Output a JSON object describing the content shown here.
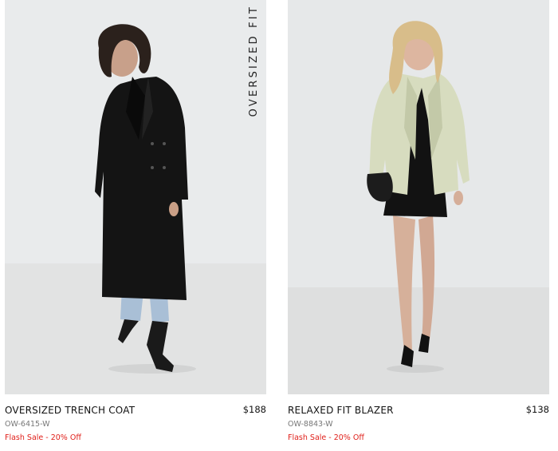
{
  "products": [
    {
      "name": "OVERSIZED TRENCH COAT",
      "sku": "OW-6415-W",
      "price": "$188",
      "promo": "Flash Sale - 20% Off",
      "image_label": "OVERSIZED FIT",
      "image_subject": "model wearing black oversized trench coat with light-wash jeans"
    },
    {
      "name": "RELAXED FIT BLAZER",
      "sku": "OW-8843-W",
      "price": "$138",
      "promo": "Flash Sale - 20% Off",
      "image_subject": "model wearing sage relaxed blazer over black mini dress"
    }
  ],
  "colors": {
    "sale_red": "#e0201b",
    "text_primary": "#111111",
    "text_muted": "#777777",
    "photo_background": "#e9ebec"
  }
}
